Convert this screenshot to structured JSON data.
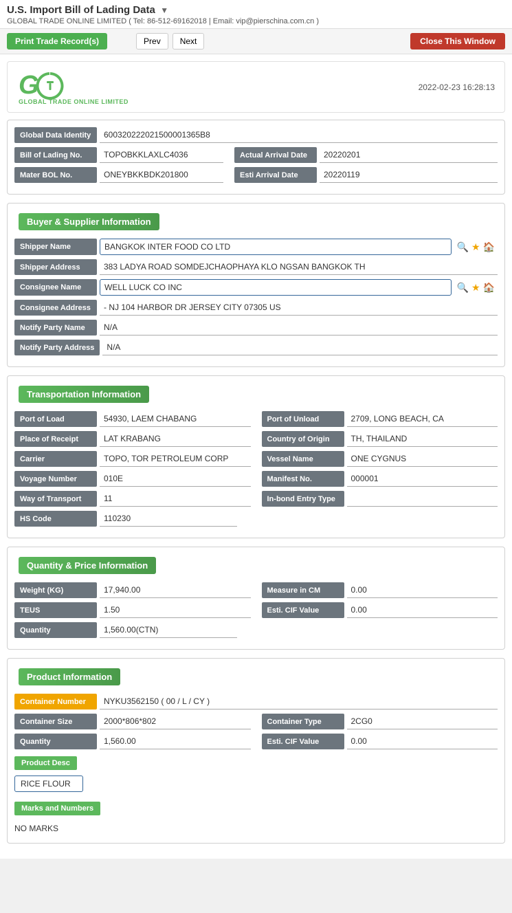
{
  "page": {
    "title": "U.S. Import Bill of Lading Data",
    "dropdown_symbol": "▼",
    "company_info": "GLOBAL TRADE ONLINE LIMITED ( Tel: 86-512-69162018 | Email: vip@pierschina.com.cn )"
  },
  "toolbar": {
    "print_label": "Print Trade Record(s)",
    "prev_label": "Prev",
    "next_label": "Next",
    "close_label": "Close This Window"
  },
  "doc_header": {
    "logo_g": "G",
    "logo_tagline": "GLOBAL TRADE ONLINE LIMITED",
    "datetime": "2022-02-23 16:28:13"
  },
  "global_data": {
    "identity_label": "Global Data Identity",
    "identity_value": "600320222021500001365B8"
  },
  "bol": {
    "bol_no_label": "Bill of Lading No.",
    "bol_no_value": "TOPOBKKLAXLC4036",
    "actual_arrival_label": "Actual Arrival Date",
    "actual_arrival_value": "20220201",
    "mater_bol_label": "Mater BOL No.",
    "mater_bol_value": "ONEYBKKBDK201800",
    "esti_arrival_label": "Esti Arrival Date",
    "esti_arrival_value": "20220119"
  },
  "buyer_supplier": {
    "section_title": "Buyer & Supplier Information",
    "shipper_name_label": "Shipper Name",
    "shipper_name_value": "BANGKOK INTER FOOD CO LTD",
    "shipper_address_label": "Shipper Address",
    "shipper_address_value": "383 LADYA ROAD SOMDEJCHAOPHAYA KLO NGSAN BANGKOK TH",
    "consignee_name_label": "Consignee Name",
    "consignee_name_value": "WELL LUCK CO INC",
    "consignee_address_label": "Consignee Address",
    "consignee_address_value": "- NJ 104 HARBOR DR JERSEY CITY 07305 US",
    "notify_party_name_label": "Notify Party Name",
    "notify_party_name_value": "N/A",
    "notify_party_address_label": "Notify Party Address",
    "notify_party_address_value": "N/A"
  },
  "transportation": {
    "section_title": "Transportation Information",
    "port_of_load_label": "Port of Load",
    "port_of_load_value": "54930, LAEM CHABANG",
    "port_of_unload_label": "Port of Unload",
    "port_of_unload_value": "2709, LONG BEACH, CA",
    "place_of_receipt_label": "Place of Receipt",
    "place_of_receipt_value": "LAT KRABANG",
    "country_of_origin_label": "Country of Origin",
    "country_of_origin_value": "TH, THAILAND",
    "carrier_label": "Carrier",
    "carrier_value": "TOPO, TOR PETROLEUM CORP",
    "vessel_name_label": "Vessel Name",
    "vessel_name_value": "ONE CYGNUS",
    "voyage_number_label": "Voyage Number",
    "voyage_number_value": "010E",
    "manifest_no_label": "Manifest No.",
    "manifest_no_value": "000001",
    "way_of_transport_label": "Way of Transport",
    "way_of_transport_value": "11",
    "inbond_entry_label": "In-bond Entry Type",
    "inbond_entry_value": "",
    "hs_code_label": "HS Code",
    "hs_code_value": "110230"
  },
  "quantity_price": {
    "section_title": "Quantity & Price Information",
    "weight_label": "Weight (KG)",
    "weight_value": "17,940.00",
    "measure_cm_label": "Measure in CM",
    "measure_cm_value": "0.00",
    "teus_label": "TEUS",
    "teus_value": "1.50",
    "esti_cif_label": "Esti. CIF Value",
    "esti_cif_value": "0.00",
    "quantity_label": "Quantity",
    "quantity_value": "1,560.00(CTN)"
  },
  "product": {
    "section_title": "Product Information",
    "container_number_label": "Container Number",
    "container_number_value": "NYKU3562150 ( 00 / L / CY )",
    "container_size_label": "Container Size",
    "container_size_value": "2000*806*802",
    "container_type_label": "Container Type",
    "container_type_value": "2CG0",
    "quantity_label": "Quantity",
    "quantity_value": "1,560.00",
    "esti_cif_label": "Esti. CIF Value",
    "esti_cif_value": "0.00",
    "product_desc_label": "Product Desc",
    "product_desc_value": "RICE FLOUR",
    "marks_label": "Marks and Numbers",
    "marks_value": "NO MARKS"
  },
  "icons": {
    "search": "🔍",
    "star": "★",
    "home": "🏠",
    "dropdown": "▼"
  }
}
